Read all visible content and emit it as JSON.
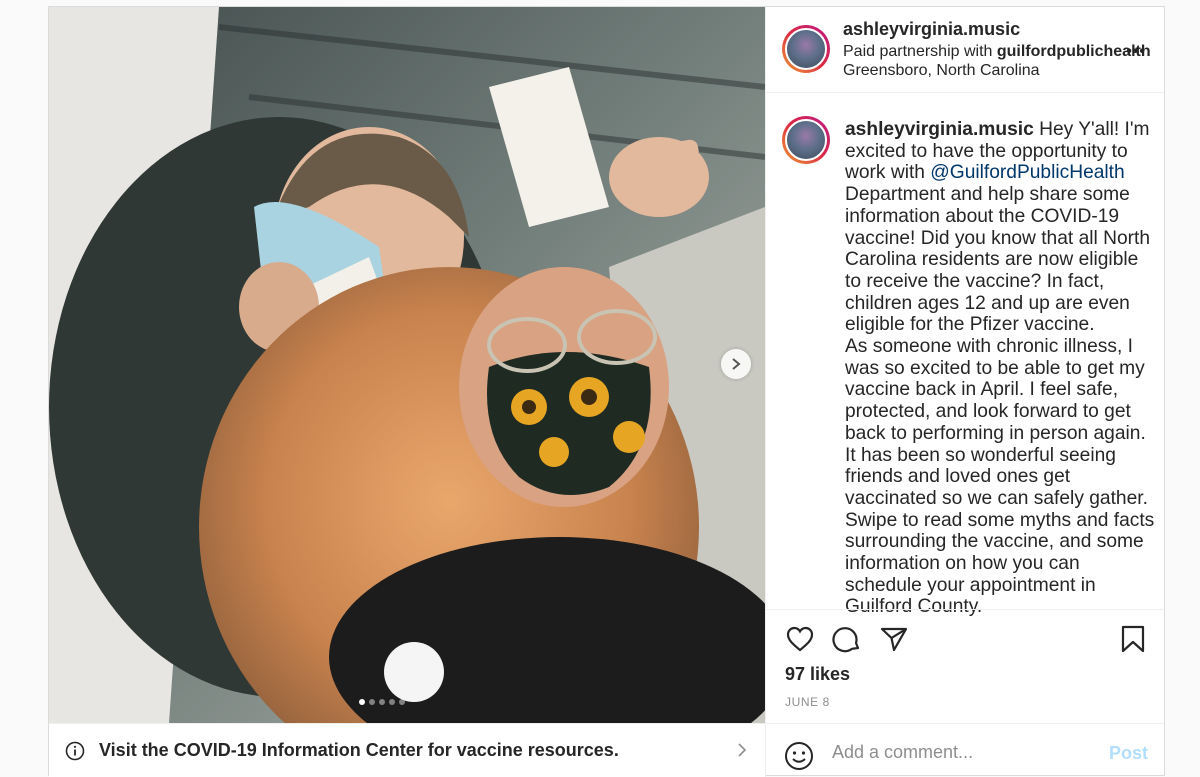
{
  "post": {
    "username": "ashleyvirginia.music",
    "partnership_prefix": "Paid partnership with ",
    "partner": "guilfordpublichealth",
    "more": "•••",
    "location": "Greensboro, North Carolina"
  },
  "media": {
    "carousel_index": 1,
    "carousel_count": 5
  },
  "info_bar": {
    "text": "Visit the COVID-19 Information Center for vaccine resources."
  },
  "caption": {
    "username": "ashleyvirginia.music",
    "text_before_mention": " Hey Y'all! I'm excited to have the opportunity to work with ",
    "mention": "@GuilfordPublicHealth",
    "text_after_mention": " Department and help share some information about the COVID-19 vaccine! Did you know that all North Carolina residents are now eligible to receive the vaccine? In fact, children ages 12 and up are even eligible for the Pfizer vaccine.",
    "paragraph2": "As someone with chronic illness, I was so excited to be able to get my vaccine back in April. I feel safe, protected, and look forward to get back to performing in person again. It has been so wonderful seeing friends and loved ones get vaccinated so we can safely gather.",
    "paragraph3": "Swipe to read some myths and facts surrounding the vaccine, and some information on how you can schedule your appointment in Guilford County."
  },
  "engagement": {
    "likes": "97 likes",
    "date": "JUNE 8"
  },
  "comment": {
    "placeholder": "Add a comment...",
    "post_label": "Post"
  },
  "icons": {
    "like": "heart-icon",
    "comment": "comment-icon",
    "share": "share-icon",
    "save": "bookmark-icon",
    "emoji": "emoji-icon",
    "info": "info-icon",
    "next": "chevron-right-icon"
  }
}
